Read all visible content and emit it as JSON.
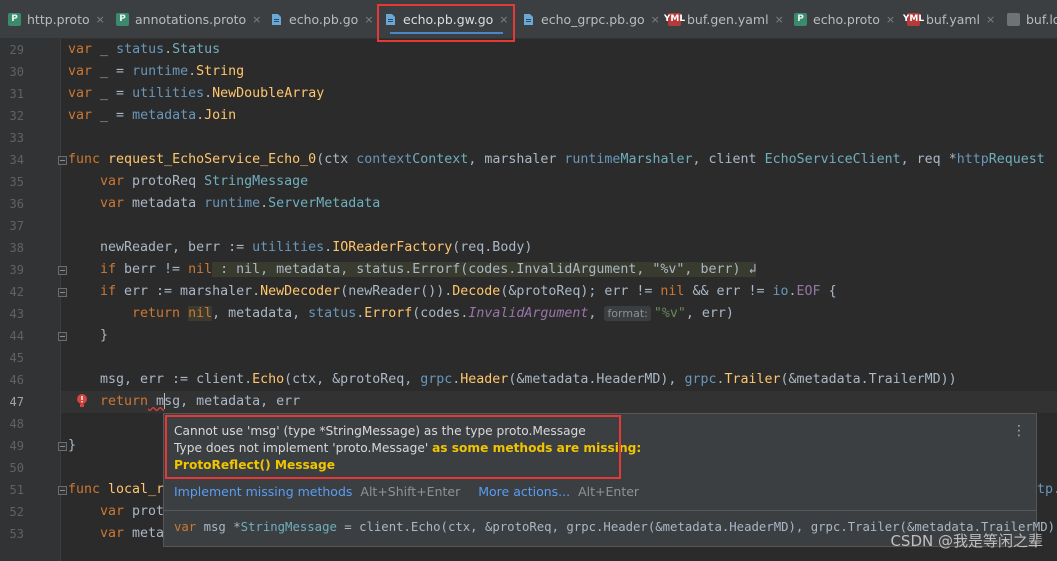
{
  "tabs": [
    {
      "label": "http.proto",
      "icon": "proto-file-icon"
    },
    {
      "label": "annotations.proto",
      "icon": "proto-file-icon"
    },
    {
      "label": "echo.pb.go",
      "icon": "go-file-icon"
    },
    {
      "label": "echo.pb.gw.go",
      "icon": "go-file-icon",
      "active": true
    },
    {
      "label": "echo_grpc.pb.go",
      "icon": "go-file-icon"
    },
    {
      "label": "buf.gen.yaml",
      "icon": "yaml-file-icon"
    },
    {
      "label": "echo.proto",
      "icon": "proto-file-icon"
    },
    {
      "label": "buf.yaml",
      "icon": "yaml-file-icon"
    },
    {
      "label": "buf.lo",
      "icon": "generic-file-icon"
    }
  ],
  "icons": {
    "proto_letter": "P",
    "yaml_letter": "YML",
    "close": "×"
  },
  "line_numbers": [
    "29",
    "30",
    "31",
    "32",
    "33",
    "34",
    "35",
    "36",
    "37",
    "38",
    "39",
    "42",
    "43",
    "44",
    "45",
    "46",
    "47",
    "48",
    "49",
    "50",
    "51",
    "52",
    "53"
  ],
  "current_line": "47",
  "code": {
    "l29": [
      "var",
      " _ ",
      "status",
      ".",
      "Status"
    ],
    "l30": [
      "var",
      " _ = ",
      "runtime",
      ".",
      "String"
    ],
    "l31": [
      "var",
      " _ = ",
      "utilities",
      ".",
      "NewDoubleArray"
    ],
    "l32": [
      "var",
      " _ = ",
      "metadata",
      ".",
      "Join"
    ],
    "l34": {
      "kw": "func",
      "name": "request_EchoService_Echo_0",
      "rest1": "(ctx ",
      "ctx_pkg": "context",
      ".": ".",
      "ctx_type": "Context",
      ", marshaler ": ", marshaler ",
      "rt": "runtime",
      "marsh": "Marshaler",
      ", client ": ", client ",
      "client_type": "EchoServiceClient",
      ", req *": ", req *",
      "http": "http",
      ".R": ".",
      "req": "Request"
    },
    "l35": [
      "var",
      " protoReq ",
      "StringMessage"
    ],
    "l36": [
      "var",
      " metadata ",
      "runtime",
      ".",
      "ServerMetadata"
    ],
    "l38": [
      "newReader, berr := ",
      "utilities",
      ".",
      "IOReaderFactory",
      "(req.Body)"
    ],
    "l39": [
      "if",
      " berr != ",
      "nil",
      " : nil, metadata, status.Errorf(codes.InvalidArgument, \"%v\", berr) ↲"
    ],
    "l42": [
      "if",
      " err := marshaler.",
      "NewDecoder",
      "(newReader()).",
      "Decode",
      "(&protoReq); err != ",
      "nil",
      " && err != ",
      "io",
      ".",
      "EOF",
      " {"
    ],
    "l43": [
      "return",
      " ",
      "nil",
      ", metadata, ",
      "status",
      ".",
      "Errorf",
      "(codes.",
      "InvalidArgument",
      ", ",
      "format:",
      " ",
      "\"%v\"",
      ", err)"
    ],
    "l44": [
      "}"
    ],
    "l46": [
      "msg, err := client.",
      "Echo",
      "(ctx, &protoReq, ",
      "grpc",
      ".",
      "Header",
      "(&metadata.HeaderMD), ",
      "grpc",
      ".",
      "Trailer",
      "(&metadata.TrailerMD))"
    ],
    "l47": [
      "return",
      " m",
      "sg, metadata, err"
    ],
    "l49": [
      "}"
    ],
    "l51": [
      "func",
      " local_r",
      "tp."
    ],
    "l52": [
      "var",
      " prot"
    ],
    "l53": [
      "var",
      " meta"
    ]
  },
  "popup": {
    "line1": "Cannot use 'msg' (type *StringMessage) as the type proto.Message",
    "line2_a": "Type does not implement 'proto.Message' ",
    "line2_b": "as some methods are missing:",
    "line3": "ProtoReflect() Message",
    "more_menu": "⋮",
    "action1": "Implement missing methods",
    "shortcut1": "Alt+Shift+Enter",
    "action2": "More actions...",
    "shortcut2": "Alt+Enter",
    "decl": [
      "var",
      " msg *",
      "StringMessage",
      " = client.Echo(ctx, &protoReq, grpc.Header(&metadata.HeaderMD), grpc.Trailer(&metadata.TrailerMD))"
    ]
  },
  "watermark": "CSDN @我是等闲之辈",
  "colors": {
    "highlight_box": "#e53935",
    "error_message_accent": "#f0c500",
    "link": "#589df6"
  }
}
